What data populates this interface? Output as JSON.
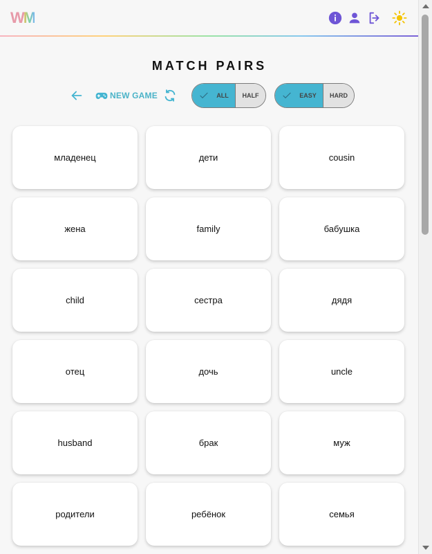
{
  "app": {
    "logo_text": "WM",
    "accent_color": "#45b5d1",
    "icon_color": "#6e55d6",
    "sun_color": "#f5c400"
  },
  "header": {
    "icons": [
      "info-icon",
      "user-icon",
      "logout-icon",
      "sun-icon"
    ]
  },
  "page": {
    "title": "MATCH PAIRS"
  },
  "controls": {
    "back_icon": "arrow-left-icon",
    "new_game_label": "NEW GAME",
    "refresh_icon": "refresh-icon",
    "scope_toggle": {
      "options": [
        "ALL",
        "HALF"
      ],
      "selected": "ALL"
    },
    "difficulty_toggle": {
      "options": [
        "EASY",
        "HARD"
      ],
      "selected": "EASY"
    }
  },
  "cards": [
    "младенец",
    "дети",
    "cousin",
    "жена",
    "family",
    "бабушка",
    "child",
    "сестра",
    "дядя",
    "отец",
    "дочь",
    "uncle",
    "husband",
    "брак",
    "муж",
    "родители",
    "ребёнок",
    "семья"
  ]
}
